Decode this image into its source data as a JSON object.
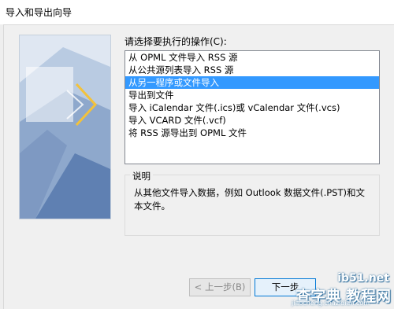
{
  "window": {
    "title": "导入和导出向导"
  },
  "prompt": "请选择要执行的操作(C):",
  "actions": [
    "从 OPML 文件导入 RSS 源",
    "从公共源列表导入 RSS 源",
    "从另一程序或文件导入",
    "导出到文件",
    "导入 iCalendar 文件(.ics)或 vCalendar 文件(.vcs)",
    "导入 VCARD 文件(.vcf)",
    "将 RSS 源导出到 OPML 文件"
  ],
  "selected_index": 2,
  "description": {
    "legend": "说明",
    "text": "从其他文件导入数据，例如 Outlook 数据文件(.PST)和文本文件。"
  },
  "buttons": {
    "back": "< 上一步(B)",
    "next": "下一步"
  },
  "watermark": {
    "big": "查字典 教程网",
    "small": "jiaocheng.chazidian.com",
    "ib": "ib51.net"
  },
  "colors": {
    "selection": "#3399ff",
    "dialog_bg": "#f0f0f0"
  }
}
